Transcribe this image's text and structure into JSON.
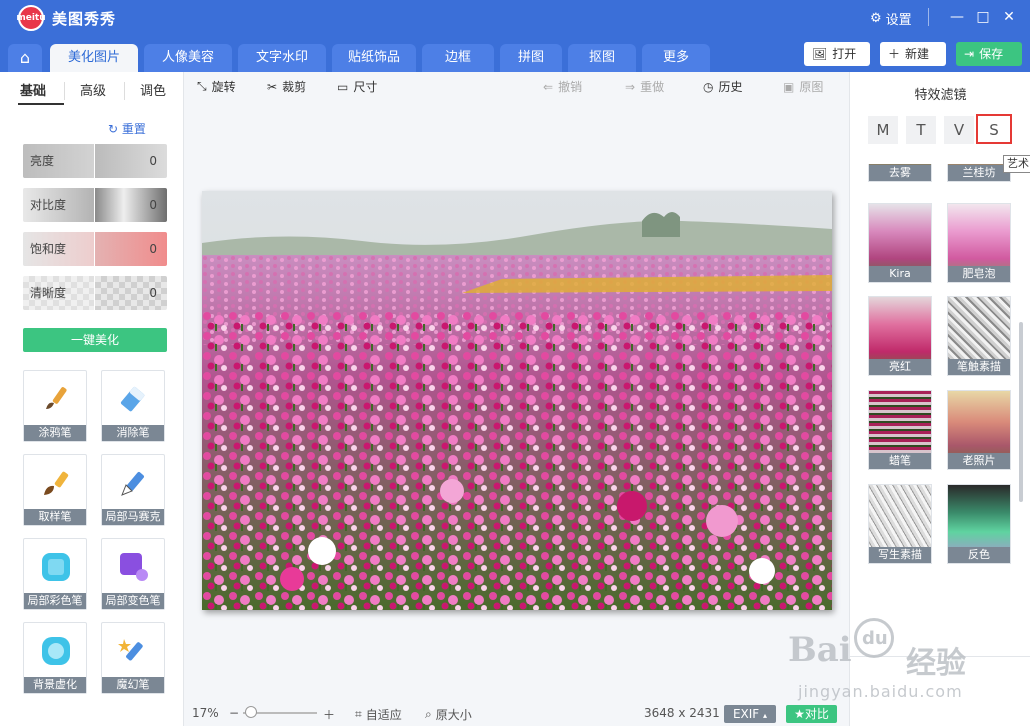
{
  "window": {
    "app_title": "美图秀秀",
    "logo_text": "meitu",
    "settings_label": "设置"
  },
  "tabs": [
    {
      "label": "美化图片",
      "active": true
    },
    {
      "label": "人像美容"
    },
    {
      "label": "文字水印"
    },
    {
      "label": "贴纸饰品"
    },
    {
      "label": "边框"
    },
    {
      "label": "拼图"
    },
    {
      "label": "抠图"
    },
    {
      "label": "更多"
    }
  ],
  "header_buttons": {
    "open": "打开",
    "new": "新建",
    "save": "保存"
  },
  "left": {
    "tabs": [
      "基础",
      "高级",
      "调色"
    ],
    "reset": "重置",
    "sliders": [
      {
        "label": "亮度",
        "value": "0"
      },
      {
        "label": "对比度",
        "value": "0"
      },
      {
        "label": "饱和度",
        "value": "0"
      },
      {
        "label": "清晰度",
        "value": "0"
      }
    ],
    "one_click": "一键美化",
    "tools": [
      "涂鸦笔",
      "消除笔",
      "取样笔",
      "局部马赛克",
      "局部彩色笔",
      "局部变色笔",
      "背景虚化",
      "魔幻笔"
    ]
  },
  "toolbar": {
    "rotate": "旋转",
    "crop": "裁剪",
    "size": "尺寸",
    "undo": "撤销",
    "redo": "重做",
    "history": "历史",
    "original": "原图"
  },
  "bottom": {
    "zoom": "17%",
    "fit": "自适应",
    "actual": "原大小",
    "dimensions": "3648 x 2431",
    "exif": "EXIF",
    "compare": "对比"
  },
  "right": {
    "title": "特效滤镜",
    "letters": [
      "M",
      "T",
      "V",
      "S"
    ],
    "selected_letter": "S",
    "tooltip": "艺术",
    "filters": [
      "去雾",
      "兰桂坊",
      "Kira",
      "肥皂泡",
      "亮红",
      "笔触素描",
      "蜡笔",
      "老照片",
      "写生素描",
      "反色"
    ]
  },
  "watermark": {
    "brand": "Bai",
    "paw_text": "du",
    "cn": "经验",
    "url": "jingyan.baidu.com"
  },
  "colors": {
    "primary": "#3b6fd8",
    "accent_green": "#3cc581",
    "highlight": "#e53935"
  }
}
